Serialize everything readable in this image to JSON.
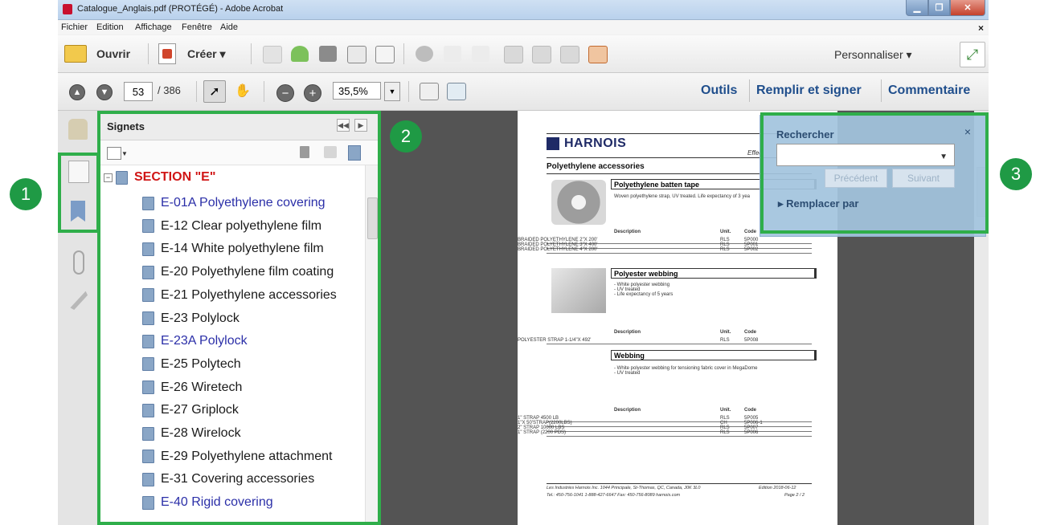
{
  "window": {
    "title": "Catalogue_Anglais.pdf (PROTÉGÉ) - Adobe Acrobat"
  },
  "menu": {
    "items": [
      "Fichier",
      "Edition",
      "Affichage",
      "Fenêtre",
      "Aide"
    ],
    "close": "×"
  },
  "toolbar1": {
    "open_label": "Ouvrir",
    "create_label": "Créer ▾",
    "personalize_label": "Personnaliser ▾"
  },
  "toolbar2": {
    "page_current": "53",
    "page_total": "/ 386",
    "zoom": "35,5%",
    "tools_label": "Outils",
    "fill_sign_label": "Remplir et signer",
    "comment_label": "Commentaire"
  },
  "bookmarks": {
    "title": "Signets",
    "section": "SECTION \"E\"",
    "items": [
      {
        "label": "E-01A Polyethylene covering",
        "highlight": true
      },
      {
        "label": "E-12 Clear polyethylene film",
        "highlight": false
      },
      {
        "label": "E-14 White polyethylene film",
        "highlight": false
      },
      {
        "label": "E-20 Polyethylene film coating",
        "highlight": false
      },
      {
        "label": "E-21 Polyethylene accessories",
        "highlight": false
      },
      {
        "label": "E-23 Polylock",
        "highlight": false
      },
      {
        "label": "E-23A Polylock",
        "highlight": true
      },
      {
        "label": "E-25 Polytech",
        "highlight": false
      },
      {
        "label": "E-26 Wiretech",
        "highlight": false
      },
      {
        "label": "E-27 Griplock",
        "highlight": false
      },
      {
        "label": "E-28 Wirelock",
        "highlight": false
      },
      {
        "label": "E-29 Polyethylene attachment",
        "highlight": false
      },
      {
        "label": "E-31 Covering accessories",
        "highlight": false
      },
      {
        "label": "E-40 Rigid covering",
        "highlight": true
      }
    ]
  },
  "document_page": {
    "logo_text": "HARNOIS",
    "effective": "Effec",
    "heading": "Polyethylene accessories",
    "product1": "Polyethylene batten tape",
    "product1_desc": "Woven polyethylene strap, UV treated. Life expectancy of 3 yea",
    "col_description": "Description",
    "col_unit": "Unit.",
    "col_code": "Code",
    "rows1": [
      [
        "BRAIDED POLYETHYLENE 2\"X 200'",
        "RLS",
        "5P000"
      ],
      [
        "BRAIDED POLYETHYLENE 3\"X 400'",
        "RLS",
        "5P001"
      ],
      [
        "BRAIDED POLYETHYLENE 4\"X 200'",
        "RLS",
        "5P002"
      ]
    ],
    "product2": "Polyester webbing",
    "product2_desc": [
      "- White polyester webbing",
      "- UV treated",
      "- Life expectancy of 5 years"
    ],
    "rows2": [
      [
        "POLYESTER STRAP 1-1/4\"X 492'",
        "RLS",
        "5P008"
      ]
    ],
    "product3": "Webbing",
    "product3_desc": [
      "- White polyester webbing for tensioning fabric cover in MegaDome",
      "- UV treated"
    ],
    "rows3": [
      [
        "1\" STRAP 4500 LB",
        "RLS",
        "5P005"
      ],
      [
        "1\"X 50'STRAP(2200LBS)",
        "CH",
        "5P006-1"
      ],
      [
        "2\" STRAP 10000 LBS",
        "RLS",
        "5P007"
      ],
      [
        "1\" STRAP (2200 PDS)",
        "RLS",
        "5P006"
      ]
    ],
    "footer_left1": "Les Industries Harnois Inc. 1044 Principale, St-Thomas, QC, Canada, J0K 3L0",
    "footer_left2": "Tel.: 450-756-1041   1-888-427-6647   Fax: 450-756-8089   harnois.com",
    "footer_right1": "Edition   2018-06-12",
    "footer_right2": "Page 2 / 2"
  },
  "find": {
    "title": "Rechercher",
    "close": "×",
    "previous_label": "Précédent",
    "next_label": "Suivant",
    "replace_label": "▸ Remplacer par"
  },
  "callouts": [
    "1",
    "2",
    "3"
  ]
}
